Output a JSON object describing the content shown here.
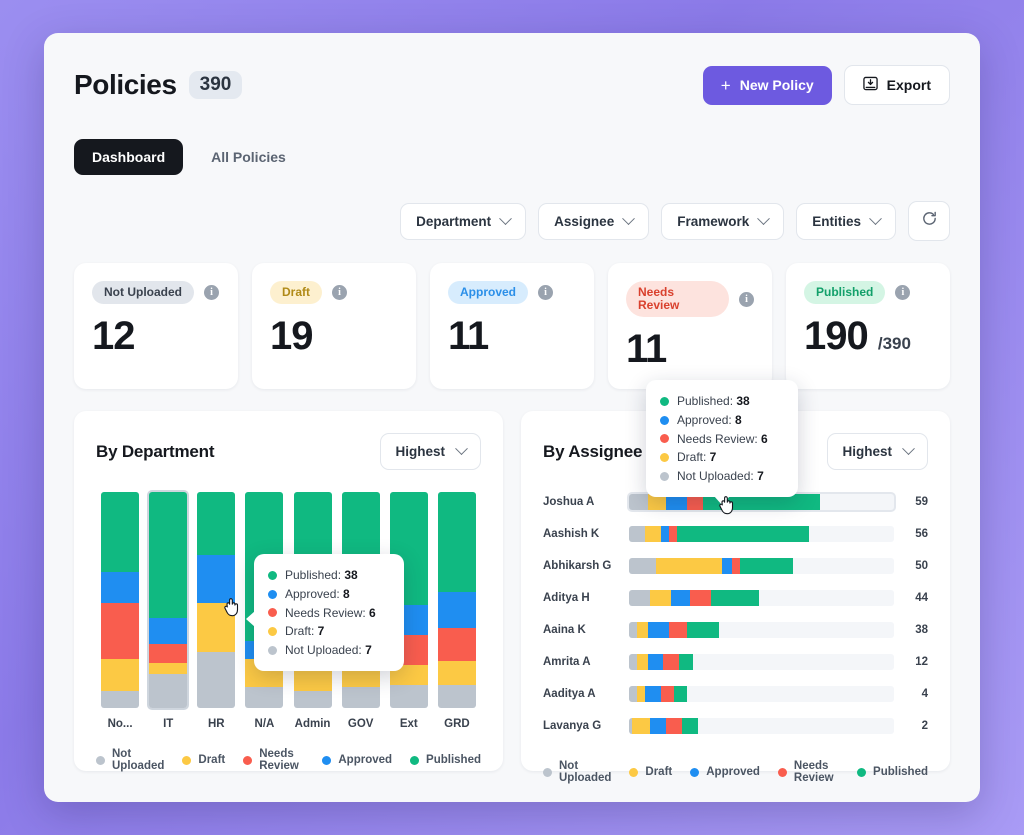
{
  "header": {
    "title": "Policies",
    "count": "390",
    "new_policy_label": "New Policy",
    "new_policy_plus": "+",
    "export_label": "Export",
    "accent": "#6d5ae0"
  },
  "tabs": [
    {
      "label": "Dashboard",
      "active": true
    },
    {
      "label": "All Policies",
      "active": false
    }
  ],
  "filters": [
    {
      "label": "Department"
    },
    {
      "label": "Assignee"
    },
    {
      "label": "Framework"
    },
    {
      "label": "Entities"
    }
  ],
  "refresh_icon": "refresh-icon",
  "stats": [
    {
      "label": "Not Uploaded",
      "value": "12",
      "denom": "",
      "pill_bg": "#e2e6ec",
      "pill_fg": "#3a424e",
      "info": "i"
    },
    {
      "label": "Draft",
      "value": "19",
      "denom": "",
      "pill_bg": "#fdf0cf",
      "pill_fg": "#b08a17",
      "info": "i"
    },
    {
      "label": "Approved",
      "value": "11",
      "denom": "",
      "pill_bg": "#d7ecfd",
      "pill_fg": "#2b8fe8",
      "info": "i"
    },
    {
      "label": "Needs Review",
      "value": "11",
      "denom": "",
      "pill_bg": "#fde3de",
      "pill_fg": "#d9412e",
      "info": "i"
    },
    {
      "label": "Published",
      "value": "190",
      "denom": "/390",
      "pill_bg": "#d4f5e4",
      "pill_fg": "#12a06a",
      "info": "i"
    }
  ],
  "colors": {
    "published": "#10b981",
    "approved": "#1f8ef1",
    "needs_review": "#f95d4e",
    "draft": "#fcc944",
    "not_uploaded": "#bcc4cd",
    "track": "#f4f6f9"
  },
  "tooltip": {
    "rows": [
      {
        "label": "Published",
        "value": "38",
        "color": "#10b981"
      },
      {
        "label": "Approved",
        "value": "8",
        "color": "#1f8ef1"
      },
      {
        "label": "Needs Review",
        "value": "6",
        "color": "#f95d4e"
      },
      {
        "label": "Draft",
        "value": "7",
        "color": "#fcc944"
      },
      {
        "label": "Not Uploaded",
        "value": "7",
        "color": "#bcc4cd"
      }
    ]
  },
  "dept_panel": {
    "title": "By Department",
    "sort_label": "Highest",
    "legend": [
      {
        "label": "Not Uploaded",
        "color": "#bcc4cd"
      },
      {
        "label": "Draft",
        "color": "#fcc944"
      },
      {
        "label": "Needs Review",
        "color": "#f95d4e"
      },
      {
        "label": "Approved",
        "color": "#1f8ef1"
      },
      {
        "label": "Published",
        "color": "#10b981"
      }
    ]
  },
  "assignee_panel": {
    "title": "By Assignee",
    "sort_label": "Highest",
    "legend": [
      {
        "label": "Not Uploaded",
        "color": "#bcc4cd"
      },
      {
        "label": "Draft",
        "color": "#fcc944"
      },
      {
        "label": "Approved",
        "color": "#1f8ef1"
      },
      {
        "label": "Needs Review",
        "color": "#f95d4e"
      },
      {
        "label": "Published",
        "color": "#10b981"
      }
    ]
  },
  "chart_data": [
    {
      "type": "bar",
      "title": "By Department",
      "stacked": true,
      "orientation": "vertical",
      "normalized": true,
      "xlabel": "",
      "ylabel": "",
      "categories": [
        "No...",
        "IT",
        "HR",
        "N/A",
        "Admin",
        "GOV",
        "Ext",
        "GRD"
      ],
      "legend": [
        "Not Uploaded",
        "Draft",
        "Needs Review",
        "Approved",
        "Published"
      ],
      "legend_position": "bottom",
      "series": [
        {
          "name": "Published",
          "color": "#10b981",
          "values": [
            37,
            58,
            29,
            69,
            56,
            54,
            52,
            46
          ]
        },
        {
          "name": "Approved",
          "color": "#1f8ef1",
          "values": [
            14,
            12,
            22,
            8,
            14,
            15,
            14,
            17
          ]
        },
        {
          "name": "Needs Review",
          "color": "#f95d4e",
          "values": [
            26,
            9,
            0,
            0,
            11,
            11,
            14,
            15
          ]
        },
        {
          "name": "Draft",
          "color": "#fcc944",
          "values": [
            15,
            5,
            23,
            13,
            11,
            10,
            9,
            11
          ]
        },
        {
          "name": "Not Uploaded",
          "color": "#bcc4cd",
          "values": [
            8,
            16,
            26,
            10,
            8,
            10,
            11,
            11
          ]
        }
      ],
      "highlighted_category": "IT",
      "tooltip": {
        "category": "IT",
        "values": {
          "Published": 38,
          "Approved": 8,
          "Needs Review": 6,
          "Draft": 7,
          "Not Uploaded": 7
        }
      }
    },
    {
      "type": "bar",
      "title": "By Assignee",
      "stacked": true,
      "orientation": "horizontal",
      "xlabel": "",
      "ylabel": "",
      "legend": [
        "Not Uploaded",
        "Draft",
        "Approved",
        "Needs Review",
        "Published"
      ],
      "legend_position": "bottom",
      "xmax": 100,
      "rows": [
        {
          "name": "Joshua A",
          "total": "59",
          "highlighted": true,
          "segments": [
            {
              "label": "Not Uploaded",
              "color": "#bcc4cd",
              "pct": 7
            },
            {
              "label": "Draft",
              "color": "#fcc944",
              "pct": 7
            },
            {
              "label": "Approved",
              "color": "#1f8ef1",
              "pct": 8
            },
            {
              "label": "Needs Review",
              "color": "#f95d4e",
              "pct": 6
            },
            {
              "label": "Published",
              "color": "#10b981",
              "pct": 44
            }
          ]
        },
        {
          "name": "Aashish K",
          "total": "56",
          "highlighted": false,
          "segments": [
            {
              "label": "Not Uploaded",
              "color": "#bcc4cd",
              "pct": 6
            },
            {
              "label": "Draft",
              "color": "#fcc944",
              "pct": 6
            },
            {
              "label": "Approved",
              "color": "#1f8ef1",
              "pct": 3
            },
            {
              "label": "Needs Review",
              "color": "#f95d4e",
              "pct": 3
            },
            {
              "label": "Published",
              "color": "#10b981",
              "pct": 50
            }
          ]
        },
        {
          "name": "Abhikarsh G",
          "total": "50",
          "highlighted": false,
          "segments": [
            {
              "label": "Not Uploaded",
              "color": "#bcc4cd",
              "pct": 10
            },
            {
              "label": "Draft",
              "color": "#fcc944",
              "pct": 25
            },
            {
              "label": "Approved",
              "color": "#1f8ef1",
              "pct": 4
            },
            {
              "label": "Needs Review",
              "color": "#f95d4e",
              "pct": 3
            },
            {
              "label": "Published",
              "color": "#10b981",
              "pct": 20
            }
          ]
        },
        {
          "name": "Aditya H",
          "total": "44",
          "highlighted": false,
          "segments": [
            {
              "label": "Not Uploaded",
              "color": "#bcc4cd",
              "pct": 8
            },
            {
              "label": "Draft",
              "color": "#fcc944",
              "pct": 8
            },
            {
              "label": "Approved",
              "color": "#1f8ef1",
              "pct": 7
            },
            {
              "label": "Needs Review",
              "color": "#f95d4e",
              "pct": 8
            },
            {
              "label": "Published",
              "color": "#10b981",
              "pct": 18
            }
          ]
        },
        {
          "name": "Aaina K",
          "total": "38",
          "highlighted": false,
          "segments": [
            {
              "label": "Not Uploaded",
              "color": "#bcc4cd",
              "pct": 3
            },
            {
              "label": "Draft",
              "color": "#fcc944",
              "pct": 4
            },
            {
              "label": "Approved",
              "color": "#1f8ef1",
              "pct": 8
            },
            {
              "label": "Needs Review",
              "color": "#f95d4e",
              "pct": 7
            },
            {
              "label": "Published",
              "color": "#10b981",
              "pct": 12
            }
          ]
        },
        {
          "name": "Amrita A",
          "total": "12",
          "highlighted": false,
          "segments": [
            {
              "label": "Not Uploaded",
              "color": "#bcc4cd",
              "pct": 3
            },
            {
              "label": "Draft",
              "color": "#fcc944",
              "pct": 4
            },
            {
              "label": "Approved",
              "color": "#1f8ef1",
              "pct": 6
            },
            {
              "label": "Needs Review",
              "color": "#f95d4e",
              "pct": 6
            },
            {
              "label": "Published",
              "color": "#10b981",
              "pct": 5
            }
          ]
        },
        {
          "name": "Aaditya A",
          "total": "4",
          "highlighted": false,
          "segments": [
            {
              "label": "Not Uploaded",
              "color": "#bcc4cd",
              "pct": 3
            },
            {
              "label": "Draft",
              "color": "#fcc944",
              "pct": 3
            },
            {
              "label": "Approved",
              "color": "#1f8ef1",
              "pct": 6
            },
            {
              "label": "Needs Review",
              "color": "#f95d4e",
              "pct": 5
            },
            {
              "label": "Published",
              "color": "#10b981",
              "pct": 5
            }
          ]
        },
        {
          "name": "Lavanya G",
          "total": "2",
          "highlighted": false,
          "segments": [
            {
              "label": "Not Uploaded",
              "color": "#bcc4cd",
              "pct": 1
            },
            {
              "label": "Draft",
              "color": "#fcc944",
              "pct": 7
            },
            {
              "label": "Approved",
              "color": "#1f8ef1",
              "pct": 6
            },
            {
              "label": "Needs Review",
              "color": "#f95d4e",
              "pct": 6
            },
            {
              "label": "Published",
              "color": "#10b981",
              "pct": 6
            }
          ]
        }
      ],
      "tooltip": {
        "row": "Joshua A",
        "values": {
          "Published": 38,
          "Approved": 8,
          "Needs Review": 6,
          "Draft": 7,
          "Not Uploaded": 7
        }
      }
    }
  ]
}
